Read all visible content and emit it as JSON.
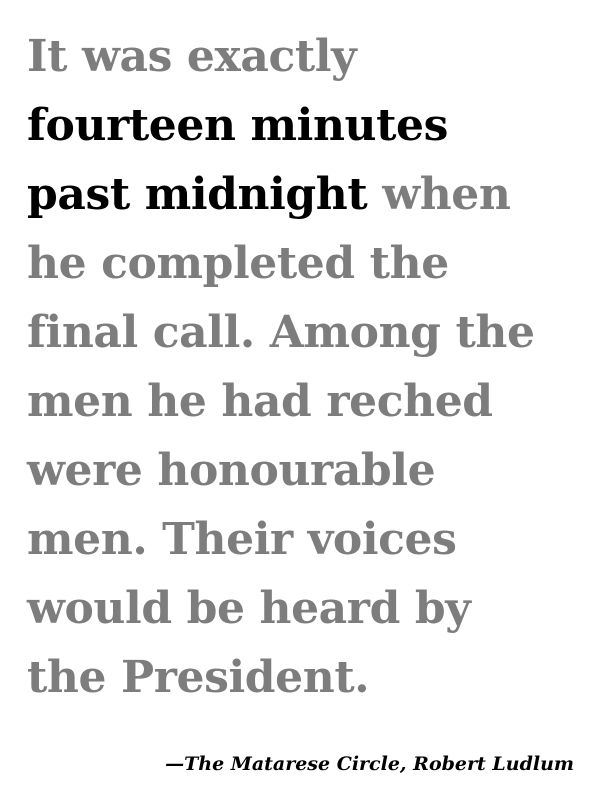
{
  "quote": {
    "lines": [
      {
        "normal_before": "It was exactly",
        "emphasis": "",
        "normal_after": ""
      },
      {
        "normal_before": "",
        "emphasis": "fourteen minutes",
        "normal_after": ""
      },
      {
        "normal_before": "",
        "emphasis": "past midnight",
        "normal_after": " when"
      },
      {
        "normal_before": "he completed the",
        "emphasis": "",
        "normal_after": ""
      },
      {
        "normal_before": "final call. Among the",
        "emphasis": "",
        "normal_after": ""
      },
      {
        "normal_before": "men he had reched",
        "emphasis": "",
        "normal_after": ""
      },
      {
        "normal_before": "were honourable",
        "emphasis": "",
        "normal_after": ""
      },
      {
        "normal_before": "men. Their voices",
        "emphasis": "",
        "normal_after": ""
      },
      {
        "normal_before": "would be heard by",
        "emphasis": "",
        "normal_after": ""
      },
      {
        "normal_before": "the President.",
        "emphasis": "",
        "normal_after": ""
      }
    ]
  },
  "attribution": "—The Matarese Circle, Robert Ludlum",
  "colors": {
    "text_muted": "#7d7d7d",
    "text_emphasis": "#000000",
    "background": "#ffffff"
  }
}
